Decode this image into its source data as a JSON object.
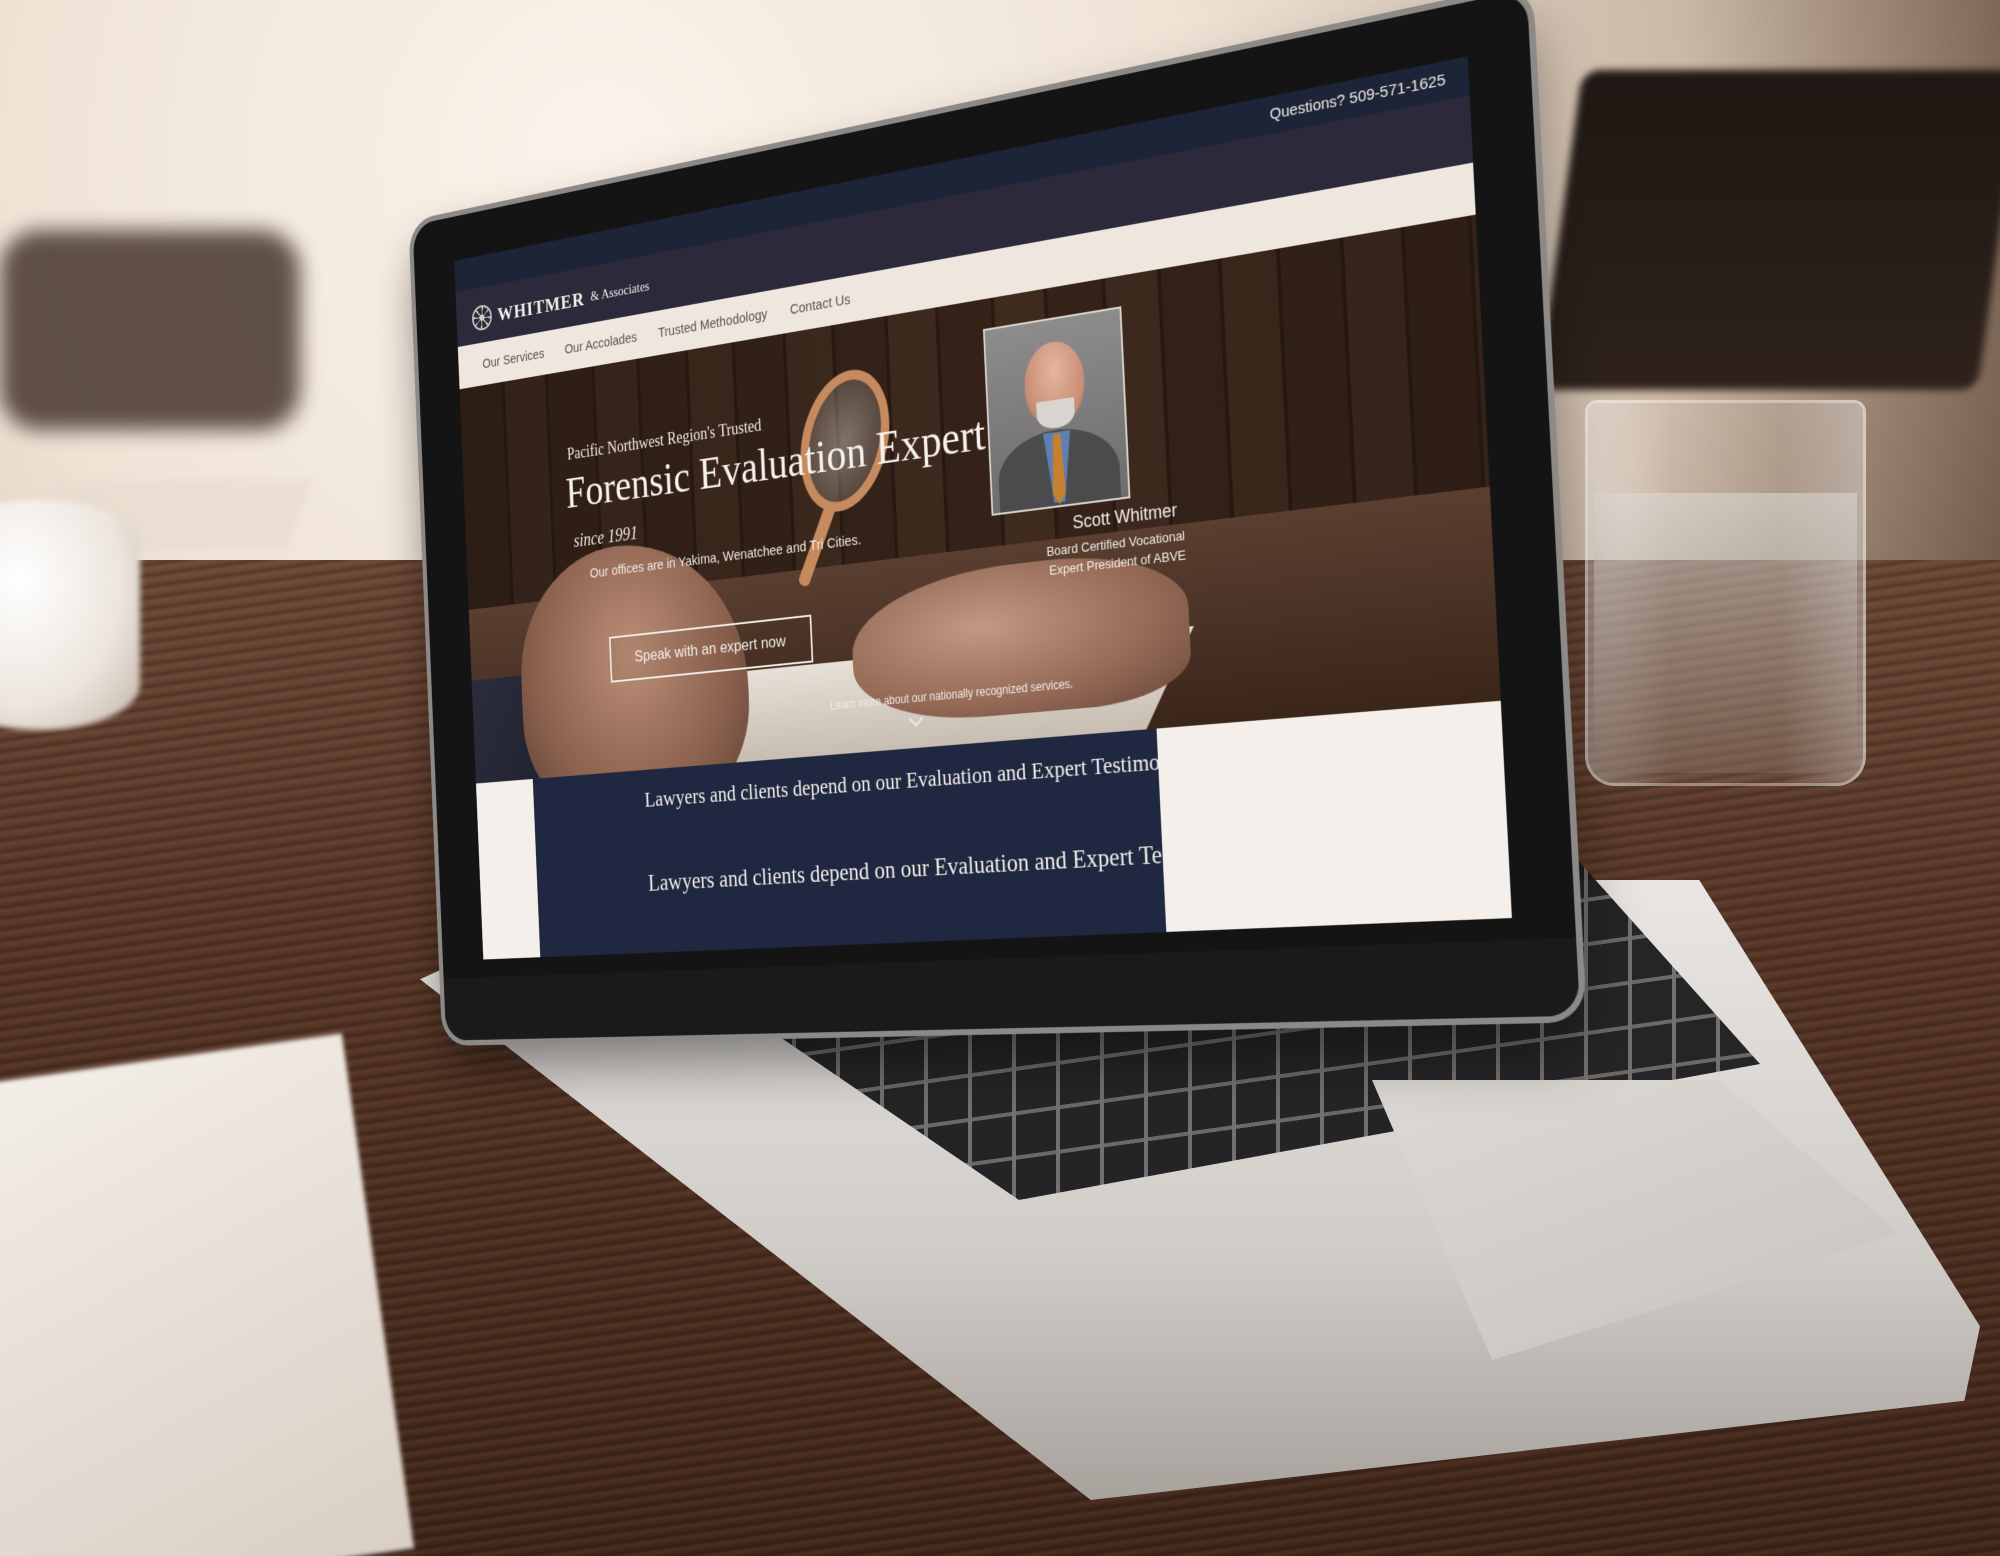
{
  "site": {
    "topbar": {
      "questions": "Questions? 509-571-1625"
    },
    "logo": {
      "name": "WHITMER",
      "suffix": "& Associates",
      "icon": "compass-icon"
    },
    "nav": {
      "items": [
        {
          "label": "Our Services"
        },
        {
          "label": "Our Accolades"
        },
        {
          "label": "Trusted Methodology"
        },
        {
          "label": "Contact Us"
        }
      ]
    },
    "hero": {
      "kicker": "Pacific Northwest Region's Trusted",
      "headline": "Forensic Evaluation Expert",
      "since": "since 1991",
      "offices": "Our offices are in Yakima, Wenatchee and Tri Cities.",
      "cta_label": "Speak with an expert now",
      "learn_more": "Learn more about our nationally recognized services.",
      "scroll_icon": "chevron-down-icon"
    },
    "profile": {
      "name": "Scott Whitmer",
      "title": "Board Certified Vocational Expert President of ABVE"
    },
    "band": {
      "line1": "Lawyers and clients depend on our Evaluation and Expert Testimony for:",
      "line2": "Lawyers and clients depend on our Evaluation and Expert Testimony for:"
    }
  },
  "colors": {
    "navy": "#1f2840",
    "cream": "#f4efea",
    "nav_text": "#5d534d"
  }
}
